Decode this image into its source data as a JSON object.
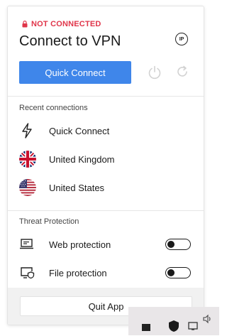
{
  "header": {
    "status_text": "NOT CONNECTED",
    "title": "Connect to VPN",
    "ip_label": "IP"
  },
  "actions": {
    "quick_connect_label": "Quick Connect"
  },
  "recent": {
    "heading": "Recent connections",
    "items": [
      {
        "label": "Quick Connect",
        "icon": "bolt-icon"
      },
      {
        "label": "United Kingdom",
        "icon": "uk-flag-icon"
      },
      {
        "label": "United States",
        "icon": "us-flag-icon"
      }
    ]
  },
  "threat": {
    "heading": "Threat Protection",
    "items": [
      {
        "label": "Web protection",
        "icon": "laptop-shield-icon",
        "enabled": false
      },
      {
        "label": "File protection",
        "icon": "monitor-shield-icon",
        "enabled": false
      }
    ]
  },
  "footer": {
    "quit_label": "Quit App"
  },
  "colors": {
    "accent": "#3f86ea",
    "status_error": "#e0354a"
  }
}
